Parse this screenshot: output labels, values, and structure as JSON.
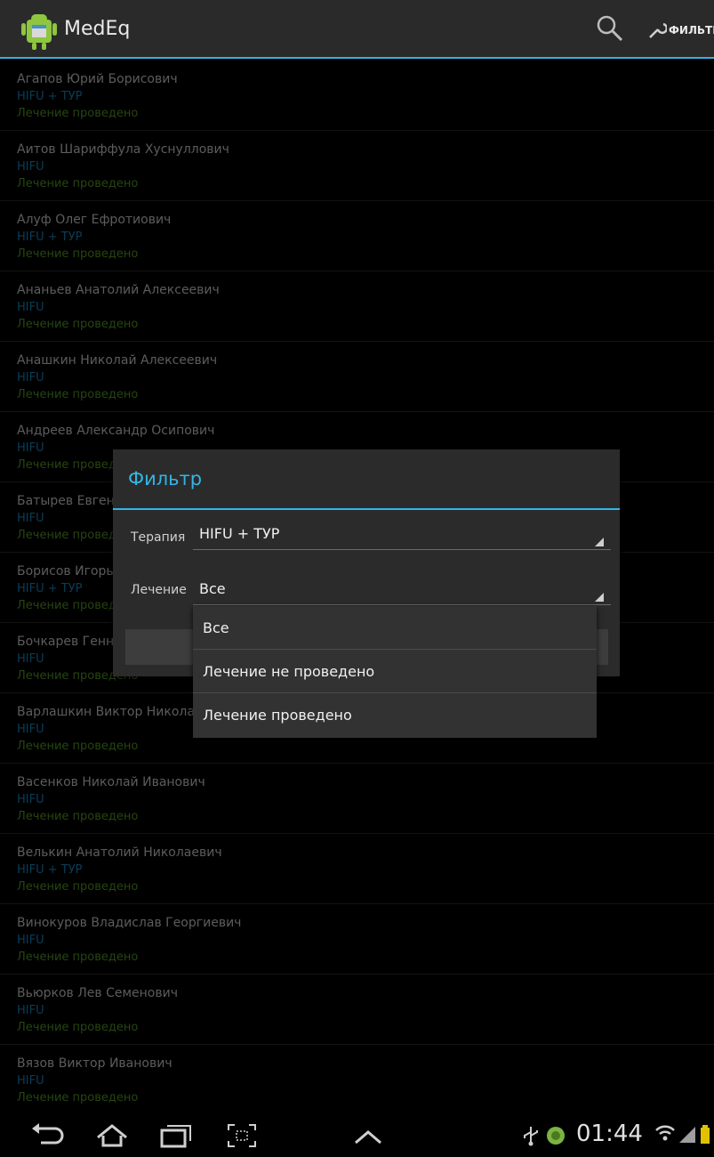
{
  "app": {
    "title": "MedEq",
    "filter_action_label": "ФИЛЬТР"
  },
  "patients": [
    {
      "name": "Агапов Юрий Борисович",
      "therapy": "HIFU + ТУР",
      "status": "Лечение проведено"
    },
    {
      "name": "Аитов Шариффула Хуснуллович",
      "therapy": "HIFU",
      "status": "Лечение проведено"
    },
    {
      "name": "Алуф Олег Ефротиович",
      "therapy": "HIFU + ТУР",
      "status": "Лечение проведено"
    },
    {
      "name": "Ананьев Анатолий Алексеевич",
      "therapy": "HIFU",
      "status": "Лечение проведено"
    },
    {
      "name": "Анашкин Николай Алексеевич",
      "therapy": "HIFU",
      "status": "Лечение проведено"
    },
    {
      "name": "Андреев Александр Осипович",
      "therapy": "HIFU",
      "status": "Лечение проведено"
    },
    {
      "name": "Батырев Евгений",
      "therapy": "HIFU",
      "status": "Лечение проведено"
    },
    {
      "name": "Борисов Игорь",
      "therapy": "HIFU + ТУР",
      "status": "Лечение проведено"
    },
    {
      "name": "Бочкарев Генна",
      "therapy": "HIFU",
      "status": "Лечение проведено"
    },
    {
      "name": "Варлашкин Виктор Николаевич",
      "therapy": "HIFU",
      "status": "Лечение проведено"
    },
    {
      "name": "Васенков Николай Иванович",
      "therapy": "HIFU",
      "status": "Лечение проведено"
    },
    {
      "name": "Велькин Анатолий Николаевич",
      "therapy": "HIFU + ТУР",
      "status": "Лечение проведено"
    },
    {
      "name": "Винокуров Владислав Георгиевич",
      "therapy": "HIFU",
      "status": "Лечение проведено"
    },
    {
      "name": "Вьюрков Лев Семенович",
      "therapy": "HIFU",
      "status": "Лечение проведено"
    },
    {
      "name": "Вязов Виктор Иванович",
      "therapy": "HIFU",
      "status": "Лечение проведено"
    }
  ],
  "dialog": {
    "title": "Фильтр",
    "therapy_label": "Терапия",
    "therapy_value": "HIFU + ТУР",
    "treatment_label": "Лечение",
    "treatment_value": "Все"
  },
  "dropdown": {
    "options": [
      "Все",
      "Лечение не проведено",
      "Лечение проведено"
    ]
  },
  "status_bar": {
    "time": "01:44"
  },
  "colors": {
    "accent": "#33b5e5",
    "therapy_text": "#105f85",
    "status_text": "#3b6b1a"
  },
  "icons": [
    "app-icon",
    "search-icon",
    "wrench-icon",
    "back-icon",
    "home-icon",
    "recent-apps-icon",
    "screenshot-icon",
    "up-arrow-icon",
    "usb-icon",
    "android-icon",
    "wifi-icon",
    "signal-icon"
  ]
}
